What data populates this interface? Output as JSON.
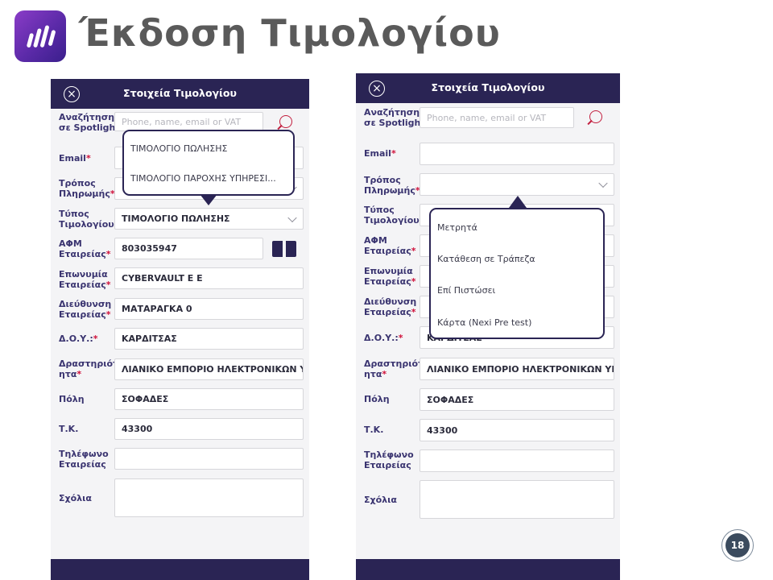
{
  "slide": {
    "title": "Έκδοση Τιμολογίου",
    "page_number": "18"
  },
  "left_panel": {
    "header_title": "Στοιχεία Τιμολογίου",
    "fields": {
      "search": {
        "label": "Αναζήτηση\nσε Spotlight",
        "placeholder": "Phone, name, email or VAT"
      },
      "email": {
        "label": "Email",
        "value": ""
      },
      "payment": {
        "label": "Τρόπος\nΠληρωμής",
        "value": ""
      },
      "invoice_type": {
        "label": "Τύπος\nΤιμολογίου",
        "value": "ΤΙΜΟΛΟΓΙΟ ΠΩΛΗΣΗΣ"
      },
      "vat": {
        "label": "ΑΦΜ\nΕταιρείας",
        "value": "803035947"
      },
      "company_name": {
        "label": "Επωνυμία\nΕταιρείας",
        "value": "CYBERVAULT E E"
      },
      "address": {
        "label": "Διεύθυνση\nΕταιρείας",
        "value": "ΜΑΤΑΡΑΓΚΑ 0"
      },
      "tax_office": {
        "label": "Δ.Ο.Υ.:",
        "value": "ΚΑΡΔΙΤΣΑΣ"
      },
      "activity": {
        "label": "Δραστηριότ\nητα",
        "value": "ΛΙΑΝΙΚΟ ΕΜΠΟΡΙΟ ΗΛΕΚΤΡΟΝΙΚΩΝ ΥΠ..."
      },
      "city": {
        "label": "Πόλη",
        "value": "ΣΟΦΑΔΕΣ"
      },
      "postal_code": {
        "label": "Τ.Κ.",
        "value": "43300"
      },
      "phone": {
        "label": "Τηλέφωνο\nΕταιρείας",
        "value": ""
      },
      "comments": {
        "label": "Σχόλια",
        "value": ""
      }
    },
    "dropdown_options": [
      "ΤΙΜΟΛΟΓΙΟ ΠΩΛΗΣΗΣ",
      "ΤΙΜΟΛΟΓΙΟ ΠΑΡΟΧΗΣ ΥΠΗΡΕΣΙ..."
    ]
  },
  "right_panel": {
    "header_title": "Στοιχεία Τιμολογίου",
    "fields": {
      "search": {
        "label": "Αναζήτηση\nσε Spotlight",
        "placeholder": "Phone, name, email or VAT"
      },
      "email": {
        "label": "Email",
        "value": ""
      },
      "payment": {
        "label": "Τρόπος\nΠληρωμής",
        "value": ""
      },
      "invoice_type": {
        "label": "Τύπος\nΤιμολογίου",
        "value": ""
      },
      "vat": {
        "label": "ΑΦΜ\nΕταιρείας",
        "value": ""
      },
      "company_name": {
        "label": "Επωνυμία\nΕταιρείας",
        "value": ""
      },
      "address": {
        "label": "Διεύθυνση\nΕταιρείας",
        "value": ""
      },
      "tax_office": {
        "label": "Δ.Ο.Υ.:",
        "value": "ΚΑΡΔΙΤΣΑΣ"
      },
      "activity": {
        "label": "Δραστηριότ\nητα",
        "value": "ΛΙΑΝΙΚΟ ΕΜΠΟΡΙΟ ΗΛΕΚΤΡΟΝΙΚΩΝ ΥΠ..."
      },
      "city": {
        "label": "Πόλη",
        "value": "ΣΟΦΑΔΕΣ"
      },
      "postal_code": {
        "label": "Τ.Κ.",
        "value": "43300"
      },
      "phone": {
        "label": "Τηλέφωνο\nΕταιρείας",
        "value": ""
      },
      "comments": {
        "label": "Σχόλια",
        "value": ""
      }
    },
    "dropdown_options": [
      "Μετρητά",
      "Κατάθεση σε Τράπεζα",
      "Επί Πιστώσει",
      "Κάρτα (Nexi Pre test)"
    ]
  },
  "required_mark": "*",
  "icons": {
    "close": "close-icon",
    "search": "search-icon",
    "book": "book-icon",
    "chevron": "chevron-down-icon"
  },
  "colors": {
    "header": "#2a2454",
    "required": "#d0103a",
    "label": "#3a3470"
  }
}
